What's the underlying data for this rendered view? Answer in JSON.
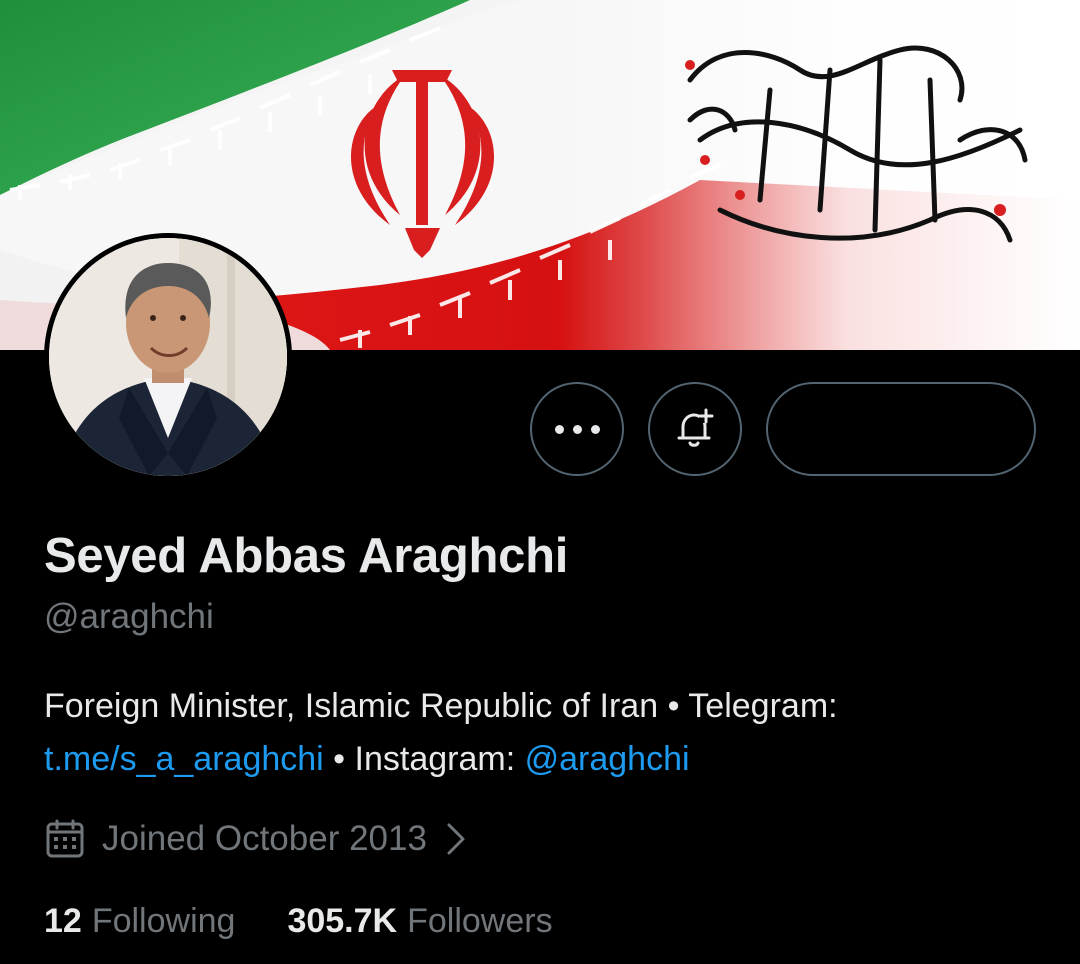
{
  "banner": {
    "calligraphy": "چو ایران نباشد تن من مباد",
    "colors": {
      "green": "#239f40",
      "white": "#ffffff",
      "red": "#da0000"
    }
  },
  "profile": {
    "name": "Seyed Abbas Araghchi",
    "handle": "@araghchi",
    "bio": {
      "line1": "Foreign Minister, Islamic Republic of Iran • Telegram:",
      "link1": "t.me/s_a_araghchi",
      "mid": " • Instagram: ",
      "link2": "@araghchi"
    },
    "joined": "Joined October 2013",
    "following_count": "12",
    "following_label": "Following",
    "followers_count": "305.7K",
    "followers_label": "Followers"
  },
  "actions": {
    "more_icon": "more-dots-icon",
    "notify_icon": "bell-plus-icon",
    "follow_label": ""
  },
  "colors": {
    "link": "#1d9bf0",
    "muted": "#71767b",
    "text": "#e7e9ea",
    "border": "#536471"
  }
}
